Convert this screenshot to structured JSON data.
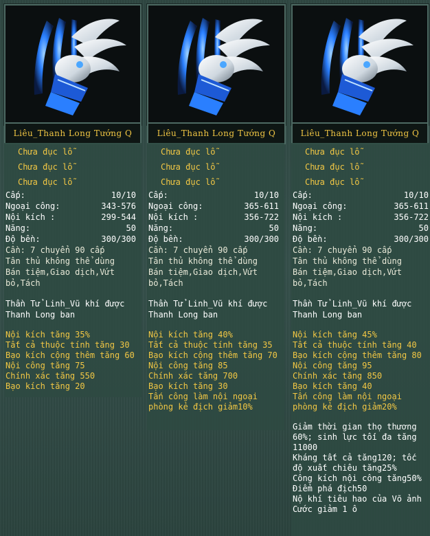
{
  "cards": [
    {
      "title": "Liêu_Thanh Long Tướng Q",
      "sockets": [
        "Chưa đục lỗ",
        "Chưa đục lỗ",
        "Chưa đục lỗ"
      ],
      "stats": [
        {
          "label": "Cấp:",
          "value": "10/10"
        },
        {
          "label": "Ngoại công:",
          "value": "343-576"
        },
        {
          "label": "Nội kích :",
          "value": "299-544"
        },
        {
          "label": "Năng:",
          "value": "50"
        },
        {
          "label": "Độ bền:",
          "value": "300/300"
        }
      ],
      "req": "Cần: 7 chuyển 90 cấp",
      "restrict1": "Tân thủ không thể dùng",
      "restrict2": "Bán tiệm,Giao dịch,Vứt",
      "restrict3": "bỏ,Tách",
      "desc1": "Thần Tử Linh_Vũ khí được",
      "desc2": "Thanh Long ban",
      "bonuses": [
        "Nội kích tăng 35%",
        "Tất cả thuộc tính tăng 30",
        "Bạo kích cộng thêm tăng 60",
        "Nội công tăng 75",
        "Chính xác tăng 550",
        "Bạo kích tăng 20"
      ]
    },
    {
      "title": "Liêu_Thanh Long Tướng Q",
      "sockets": [
        "Chưa đục lỗ",
        "Chưa đục lỗ",
        "Chưa đục lỗ"
      ],
      "stats": [
        {
          "label": "Cấp:",
          "value": "10/10"
        },
        {
          "label": "Ngoại công:",
          "value": "365-611"
        },
        {
          "label": "Nội kích :",
          "value": "356-722"
        },
        {
          "label": "Năng:",
          "value": "50"
        },
        {
          "label": "Độ bền:",
          "value": "300/300"
        }
      ],
      "req": "Cần: 7 chuyển 90 cấp",
      "restrict1": "Tân thủ không thể dùng",
      "restrict2": "Bán tiệm,Giao dịch,Vứt",
      "restrict3": "bỏ,Tách",
      "desc1": "Thần Tử Linh_Vũ khí được",
      "desc2": "Thanh Long ban",
      "bonuses": [
        "Nội kích tăng 40%",
        "Tất cả thuộc tính tăng 35",
        "Bạo kích cộng thêm tăng 70",
        "Nội công tăng 85",
        "Chính xác tăng 700",
        "Bạo kích tăng 30",
        "Tấn công làm nội ngoại",
        "phòng kẻ địch giảm10%"
      ]
    },
    {
      "title": "Liêu_Thanh Long Tướng Q",
      "sockets": [
        "Chưa đục lỗ",
        "Chưa đục lỗ",
        "Chưa đục lỗ"
      ],
      "stats": [
        {
          "label": "Cấp:",
          "value": "10/10"
        },
        {
          "label": "Ngoại công:",
          "value": "365-611"
        },
        {
          "label": "Nội kích :",
          "value": "356-722"
        },
        {
          "label": "Năng:",
          "value": "50"
        },
        {
          "label": "Độ bền:",
          "value": "300/300"
        }
      ],
      "req": "Cần: 7 chuyển 90 cấp",
      "restrict1": "Tân thủ không thể dùng",
      "restrict2": "Bán tiệm,Giao dịch,Vứt",
      "restrict3": "bỏ,Tách",
      "desc1": "Thần Tử Linh_Vũ khí được",
      "desc2": "Thanh Long ban",
      "bonuses": [
        "Nội kích tăng 45%",
        "Tất cả thuộc tính tăng 40",
        "Bạo kích cộng thêm tăng 80",
        "Nội công tăng 95",
        "Chính xác tăng 850",
        "Bạo kích tăng 40",
        "Tấn công làm nội ngoại",
        "phòng kẻ địch giảm20%"
      ],
      "extra": [
        "Giảm thời gian thọ thương",
        "60%; sinh lực tối đa tăng",
        "11000",
        "Kháng tất cả tăng120; tốc",
        "độ xuất chiêu tăng25%",
        "Công kích nội công tăng50%",
        "Điểm phá địch50",
        "Nộ khí tiêu hao của Võ ảnh",
        "Cước giảm 1 ô"
      ]
    }
  ],
  "colors": {
    "gold": "#f2c744",
    "panel": "#2e4a42",
    "frame": "#4d6a63",
    "weapon_blue": "#2a7fff",
    "weapon_silver": "#cfd8e0"
  },
  "icon": "dragon-claw-weapon-icon"
}
